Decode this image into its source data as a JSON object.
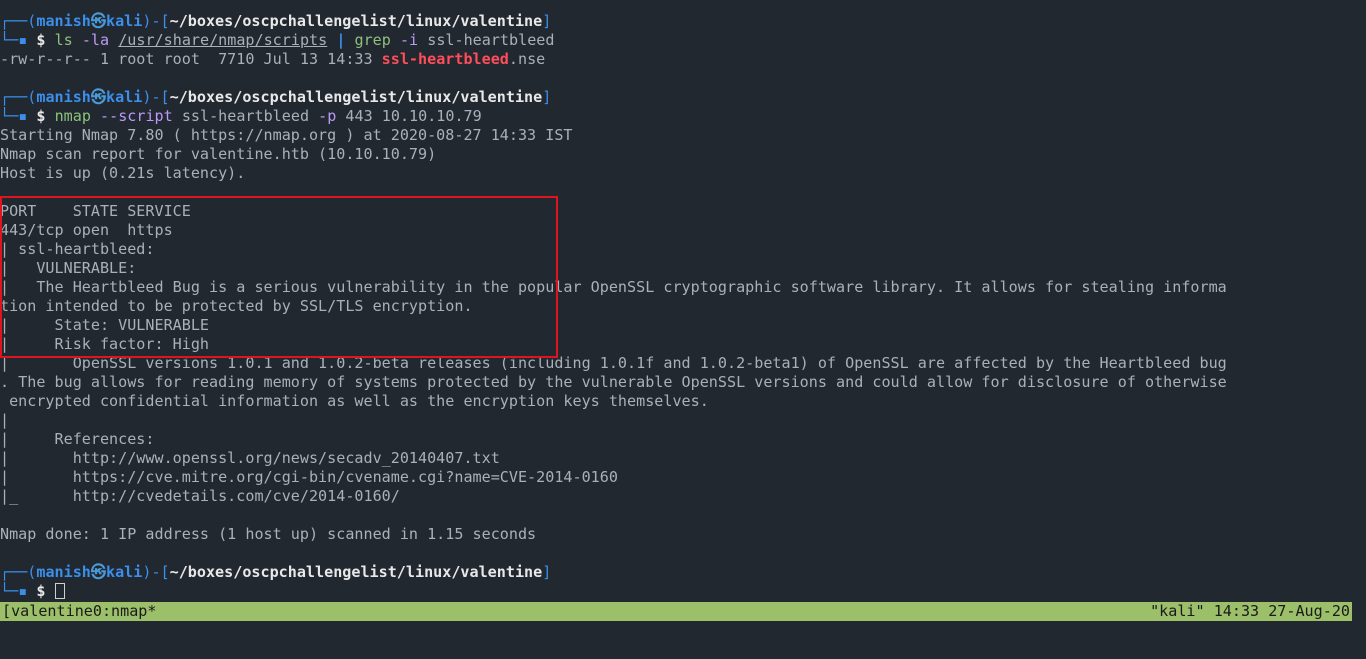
{
  "prompt": {
    "frame_open": "┌──(",
    "user": "manish",
    "skull": "㉿",
    "host": "kali",
    "frame_mid": ")-[",
    "path": "~/boxes/oscpchallengelist/linux/valentine",
    "frame_close": "]",
    "frame_bottom": "└─",
    "dollar": "$"
  },
  "cmd1": {
    "program": "ls",
    "flags": "-la",
    "target": "/usr/share/nmap/scripts",
    "pipe": "|",
    "grep": "grep",
    "grep_flag": "-i",
    "grep_pattern": "ssl-heartbleed"
  },
  "ls_output": {
    "prefix": "-rw-r--r-- 1 root root  7710 Jul 13 14:33 ",
    "match": "ssl-heartbleed",
    "suffix": ".nse"
  },
  "cmd2": {
    "program": "nmap",
    "flag1": "--script",
    "script": "ssl-heartbleed",
    "flag2": "-p",
    "rest": "443 10.10.10.79"
  },
  "nmap_output": [
    "Starting Nmap 7.80 ( https://nmap.org ) at 2020-08-27 14:33 IST",
    "Nmap scan report for valentine.htb (10.10.10.79)",
    "Host is up (0.21s latency).",
    "",
    "PORT    STATE SERVICE",
    "443/tcp open  https",
    "| ssl-heartbleed:",
    "|   VULNERABLE:",
    "|   The Heartbleed Bug is a serious vulnerability in the popular OpenSSL cryptographic software library. It allows for stealing informa",
    "tion intended to be protected by SSL/TLS encryption.",
    "|     State: VULNERABLE",
    "|     Risk factor: High",
    "|       OpenSSL versions 1.0.1 and 1.0.2-beta releases (including 1.0.1f and 1.0.2-beta1) of OpenSSL are affected by the Heartbleed bug",
    ". The bug allows for reading memory of systems protected by the vulnerable OpenSSL versions and could allow for disclosure of otherwise",
    " encrypted confidential information as well as the encryption keys themselves.",
    "|",
    "|     References:",
    "|       http://www.openssl.org/news/secadv_20140407.txt",
    "|       https://cve.mitre.org/cgi-bin/cvename.cgi?name=CVE-2014-0160",
    "|_      http://cvedetails.com/cve/2014-0160/",
    "",
    "Nmap done: 1 IP address (1 host up) scanned in 1.15 seconds"
  ],
  "status_bar": {
    "left": "[valentine0:nmap*",
    "right": "\"kali\" 14:33 27-Aug-20"
  },
  "colors": {
    "background": "#222830",
    "frame_blue": "#3b8eea",
    "command_green": "#8ec07c",
    "match_red": "#ff4d5a",
    "status_bar_green": "#9cbf6a",
    "highlight_red": "#e0141f"
  }
}
